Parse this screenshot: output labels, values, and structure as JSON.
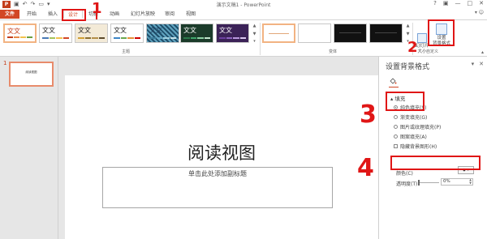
{
  "titlebar": {
    "app_logo": "P",
    "doc_title": "演示文稿1 - PowerPoint",
    "help": "?",
    "minimize": "—",
    "restore": "□",
    "close": "✕"
  },
  "tabs": [
    "文件",
    "开始",
    "插入",
    "设计",
    "切换",
    "动画",
    "幻灯片放映",
    "审阅",
    "视图"
  ],
  "user": "▾ ☺",
  "ribbon": {
    "themes": [
      {
        "label": "文文",
        "color": "#c43e1c",
        "bar": [
          "#c43e1c",
          "#e88b4a",
          "#f2c14e",
          "#6a9e3f"
        ]
      },
      {
        "label": "文文",
        "color": "#222222",
        "bar": [
          "#4a7ab5",
          "#a5c35a",
          "#f2c14e",
          "#d24726"
        ]
      },
      {
        "label": "文文",
        "color": "#222222",
        "bar": [
          "#d1a035",
          "#8a6d2f",
          "#b38f49",
          "#5c4a2a"
        ]
      },
      {
        "label": "文文",
        "color": "#222222",
        "bar": [
          "#3d85c6",
          "#6aa84f",
          "#e69138",
          "#cc0000"
        ]
      },
      {
        "label": "文文",
        "color": "#1e3d5c",
        "bar": [
          "#3c7c9a",
          "#63a6c4",
          "#9fd0e0",
          "#c6e2e9"
        ]
      },
      {
        "label": "文文",
        "color": "#ffffff",
        "bar": [
          "#2c7a4b",
          "#3ea66b",
          "#8bd0a4",
          "#c3e6cf"
        ]
      },
      {
        "label": "文文",
        "color": "#ffffff",
        "bar": [
          "#6b3fa0",
          "#8e64c1",
          "#b998de",
          "#d9c7ef"
        ]
      }
    ],
    "themes_group_label": "主题",
    "variants_group_label": "变体",
    "customize_group_label": "自定义",
    "slide_size_label_1": "幻灯片",
    "slide_size_label_2": "大小",
    "format_bg_label_1": "设置",
    "format_bg_label_2": "背景格式"
  },
  "thumbnails": [
    {
      "number": "1",
      "title": "阅读视图"
    }
  ],
  "slide": {
    "title": "阅读视图",
    "subtitle_placeholder": "单击此处添加副标题"
  },
  "format_pane": {
    "title": "设置背景格式",
    "pin_icon": "▾",
    "close_icon": "✕",
    "fill_section": "▴ 填充",
    "options": [
      "纯色填充(S)",
      "渐变填充(G)",
      "图片或纹理填充(P)",
      "图案填充(A)"
    ],
    "selected_option": 0,
    "hide_bg_graphics": "隐藏背景图形(H)",
    "color_label": "颜色(C)",
    "color_btn": "⬙ ▾",
    "transparency_label": "透明度(T)",
    "transparency_value": "0%",
    "spin_up": "▲",
    "spin_down": "▼"
  },
  "annotations": [
    "1",
    "2",
    "3",
    "4"
  ]
}
